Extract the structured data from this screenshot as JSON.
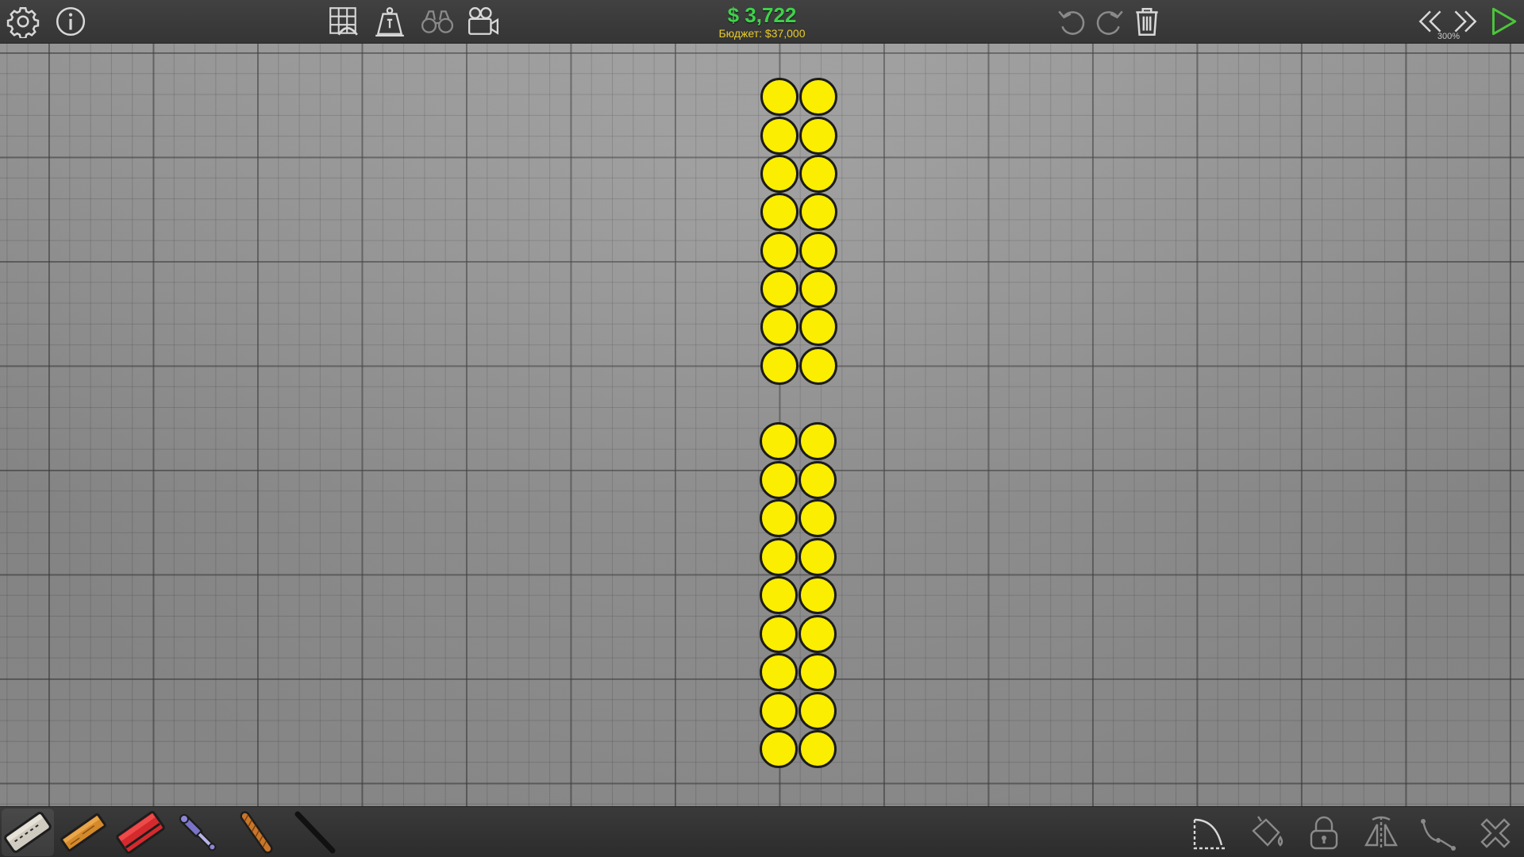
{
  "header": {
    "cost": "$ 3,722",
    "budget": "Бюджет: $37,000",
    "zoom": "300%"
  },
  "colors": {
    "cost_green": "#3fd24a",
    "budget_yellow": "#e8cc2c",
    "ball_yellow": "#fbee00",
    "ball_outline": "#1b1b1b",
    "play_green": "#4cc63a"
  },
  "toolbar_left": [
    "gear-icon",
    "info-icon"
  ],
  "toolbar_center": [
    "grid-blueprint-icon",
    "weight-icon",
    "binoculars-icon",
    "camera-icon"
  ],
  "toolbar_right": [
    "undo-icon",
    "redo-icon",
    "trash-icon",
    "rewind-icon",
    "fast-forward-icon",
    "play-icon"
  ],
  "materials": [
    {
      "name": "road",
      "selected": true
    },
    {
      "name": "wood",
      "selected": false
    },
    {
      "name": "reinforced-road",
      "selected": false
    },
    {
      "name": "hydraulic",
      "selected": false
    },
    {
      "name": "rope",
      "selected": false
    },
    {
      "name": "steel-cable",
      "selected": false
    }
  ],
  "tools": [
    "arc-tool-icon",
    "paint-bucket-icon",
    "lock-icon",
    "mirror-icon",
    "split-joint-icon",
    "close-icon"
  ],
  "scene": {
    "upper_group": {
      "columns": 2,
      "rows": 8
    },
    "lower_group": {
      "columns": 2,
      "rows": 9
    }
  }
}
